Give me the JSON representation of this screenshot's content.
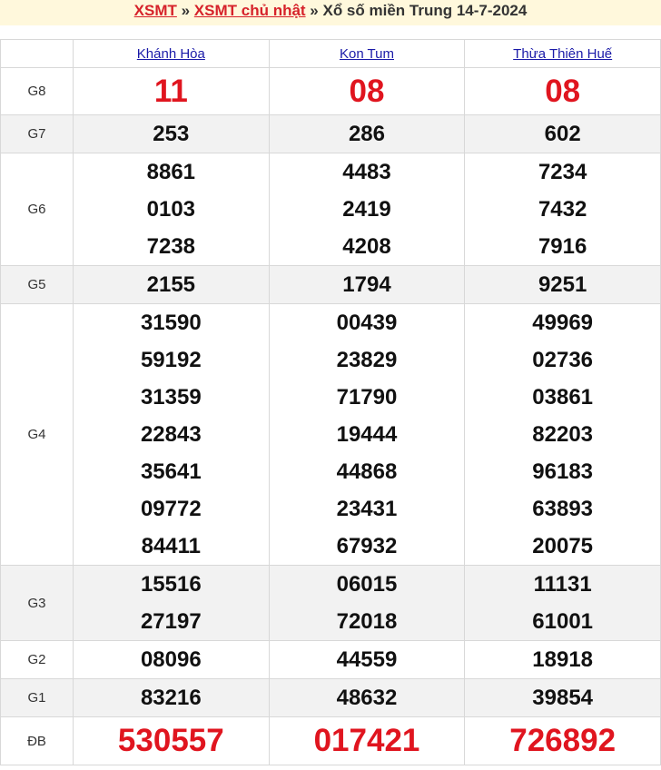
{
  "header": {
    "link1": "XSMT",
    "sep1": " » ",
    "link2": "XSMT chủ nhật",
    "sep2": " » ",
    "title": "Xổ số miền Trung 14-7-2024"
  },
  "provinces": [
    "Khánh Hòa",
    "Kon Tum",
    "Thừa Thiên Huế"
  ],
  "prizes": [
    {
      "label": "G8",
      "values": [
        [
          "11"
        ],
        [
          "08"
        ],
        [
          "08"
        ]
      ]
    },
    {
      "label": "G7",
      "values": [
        [
          "253"
        ],
        [
          "286"
        ],
        [
          "602"
        ]
      ]
    },
    {
      "label": "G6",
      "values": [
        [
          "8861",
          "0103",
          "7238"
        ],
        [
          "4483",
          "2419",
          "4208"
        ],
        [
          "7234",
          "7432",
          "7916"
        ]
      ]
    },
    {
      "label": "G5",
      "values": [
        [
          "2155"
        ],
        [
          "1794"
        ],
        [
          "9251"
        ]
      ]
    },
    {
      "label": "G4",
      "values": [
        [
          "31590",
          "59192",
          "31359",
          "22843",
          "35641",
          "09772",
          "84411"
        ],
        [
          "00439",
          "23829",
          "71790",
          "19444",
          "44868",
          "23431",
          "67932"
        ],
        [
          "49969",
          "02736",
          "03861",
          "82203",
          "96183",
          "63893",
          "20075"
        ]
      ]
    },
    {
      "label": "G3",
      "values": [
        [
          "15516",
          "27197"
        ],
        [
          "06015",
          "72018"
        ],
        [
          "11131",
          "61001"
        ]
      ]
    },
    {
      "label": "G2",
      "values": [
        [
          "08096"
        ],
        [
          "44559"
        ],
        [
          "18918"
        ]
      ]
    },
    {
      "label": "G1",
      "values": [
        [
          "83216"
        ],
        [
          "48632"
        ],
        [
          "39854"
        ]
      ]
    },
    {
      "label": "ĐB",
      "values": [
        [
          "530557"
        ],
        [
          "017421"
        ],
        [
          "726892"
        ]
      ]
    }
  ]
}
